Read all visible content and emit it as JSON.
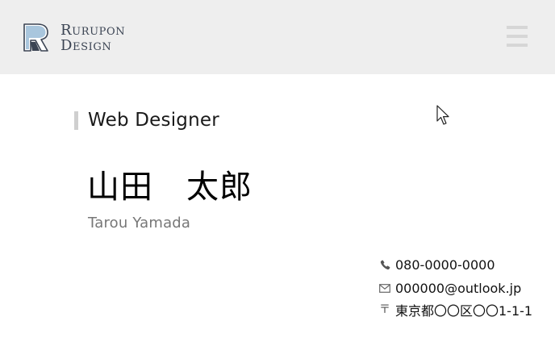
{
  "header": {
    "brand_line1": "Rurupon",
    "brand_line2": "Design",
    "menu_icon": "hamburger-menu-icon",
    "background": "#eeeeee"
  },
  "profile": {
    "role": "Web Designer",
    "name_ja": "山田　太郎",
    "name_en": "Tarou Yamada"
  },
  "contact": {
    "phone": "080-0000-0000",
    "email": "000000@outlook.jp",
    "postal_mark": "〒",
    "address": "東京都〇〇区〇〇1-1-1"
  },
  "colors": {
    "accent_bar": "#cfcfcf",
    "subtext": "#777777",
    "brand": "#3b4453"
  }
}
